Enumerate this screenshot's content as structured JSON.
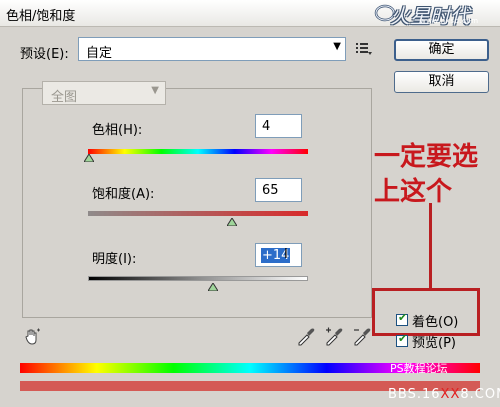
{
  "window": {
    "title": "色相/饱和度"
  },
  "logo": {
    "name": "火星时代",
    "url": "www.hxsd.com"
  },
  "preset": {
    "label": "预设(E):",
    "value": "自定"
  },
  "buttons": {
    "ok": "确定",
    "cancel": "取消"
  },
  "edit": {
    "value": "全图"
  },
  "sliders": [
    {
      "label": "色相(H):",
      "value": "4"
    },
    {
      "label": "饱和度(A):",
      "value": "65"
    },
    {
      "label": "明度(I):",
      "value": "+14"
    }
  ],
  "options": {
    "colorize_label": "着色(O)",
    "colorize_checked": true,
    "preview_label": "预览(P)",
    "preview_checked": true
  },
  "annotation": {
    "line1": "一定要选",
    "line2": "上这个"
  },
  "watermark": {
    "line1": "PS教程论坛",
    "line2_prefix": "BBS.16",
    "line2_mid": "XX",
    "line2_suffix": "8.COM"
  },
  "colors": {
    "annotation_red": "#c8181d",
    "accent_blue": "#2c6dc9"
  }
}
